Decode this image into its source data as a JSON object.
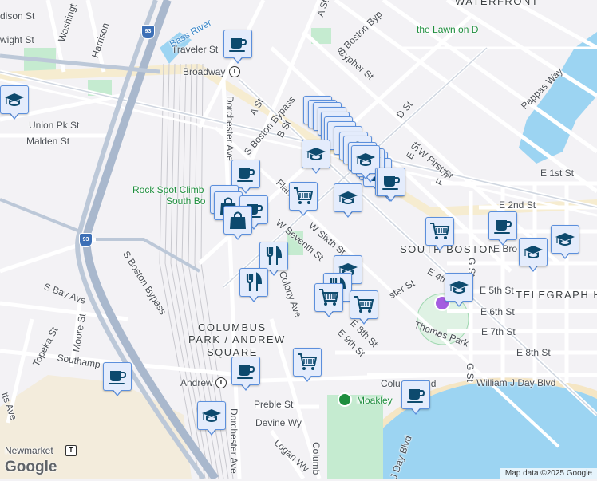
{
  "map": {
    "labels": {
      "waterfront": "WATERFRONT",
      "lawn_on_d": "the Lawn on D",
      "traveler_st": "Traveler St",
      "broadway": "Broadway",
      "bass_river": "Bass River",
      "harrison": "Harrison",
      "washington": "Washingt",
      "wight_st": "wight St",
      "dison_st": "dison St",
      "union_pk_st": "Union Pk St",
      "malden_st": "Malden St",
      "cypher_st": "Cypher St",
      "s_boston_byp_top": "S Boston Byp",
      "a_st_top": "A St",
      "a_st": "A St",
      "s_boston_bypass": "S Boston Bypass",
      "b_st": "B St",
      "dorchester_ave": "Dorchester Ave",
      "d_st": "D St",
      "w_first_st": "W First St",
      "e_st": "E St",
      "f_st": "F St",
      "e_1st_st": "E 1st St",
      "e_2nd_st": "E 2nd St",
      "pappas_way": "Pappas Way",
      "rock_spot": "Rock Spot Climb",
      "south_bo": "South Bo",
      "flaher": "Flaher",
      "w_sixth_st": "W Sixth St",
      "w_seventh_st": "W Seventh St",
      "south_boston": "SOUTH BOSTON",
      "e_bro": "E Bro",
      "e_4th_st": "E 4th St",
      "e_5th_st": "E 5th St",
      "telegraph_hill": "TELEGRAPH HI",
      "e_6th_st": "E 6th St",
      "e_7th_st": "E 7th St",
      "thomas_park": "Thomas Park",
      "g_st": "G St",
      "g_st_2": "G St",
      "e_8th_st": "E 8th St",
      "e_8th_st_2": "E 8th St",
      "e_9th_st": "E 9th St",
      "ster_st": "ster St",
      "colony_ave": "Colony Ave",
      "columbus_1": "COLUMBUS",
      "columbus_2": "PARK / ANDREW",
      "columbus_3": "SQUARE",
      "s_boston_bypass_2": "S Boston Bypass",
      "s_bay_ave": "S Bay Ave",
      "topeka_st": "Topeka St",
      "moore_st": "Moore St",
      "southampton": "Southamp",
      "andrew": "Andrew",
      "columbia_rd": "Columbia Rd",
      "william_j_day": "William J Day Blvd",
      "moakley": "Moakley",
      "preble_st": "Preble St",
      "devine_wy": "Devine Wy",
      "logan_wy": "Logan Wy",
      "columbia_v": "Columb",
      "dorchester_ave_2": "Dorchester Ave",
      "newmarket": "Newmarket",
      "j_day_blvd": "J Day Blvd",
      "tts_ave": "tts Ave"
    },
    "highway_shield": "93",
    "transit_symbol": "T",
    "attribution": "Map data ©2025 Google",
    "logo": "Google",
    "colors": {
      "marker_fill": "#e4ecfc",
      "marker_border": "#5b8fdc",
      "icon": "#0d4a6e",
      "water": "#9cd4f2",
      "park": "#c5ebd0",
      "highway": "#9fb0c8"
    },
    "markers": [
      {
        "type": "coffee"
      },
      {
        "type": "school"
      },
      {
        "type": "shopping"
      },
      {
        "type": "shopping"
      },
      {
        "type": "grocery"
      },
      {
        "type": "shopping"
      },
      {
        "type": "shopping"
      },
      {
        "type": "shopping"
      },
      {
        "type": "shopping"
      },
      {
        "type": "shopping"
      },
      {
        "type": "shopping"
      },
      {
        "type": "school"
      },
      {
        "type": "shopping"
      },
      {
        "type": "shopping"
      },
      {
        "type": "coffee"
      },
      {
        "type": "school"
      },
      {
        "type": "grocery"
      },
      {
        "type": "school"
      },
      {
        "type": "coffee"
      },
      {
        "type": "shopping"
      },
      {
        "type": "shopping"
      },
      {
        "type": "coffee"
      },
      {
        "type": "shopping"
      },
      {
        "type": "shopping"
      },
      {
        "type": "coffee"
      },
      {
        "type": "grocery"
      },
      {
        "type": "restaurant"
      },
      {
        "type": "restaurant"
      },
      {
        "type": "grocery"
      },
      {
        "type": "coffee"
      },
      {
        "type": "school"
      },
      {
        "type": "school"
      },
      {
        "type": "school"
      },
      {
        "type": "school"
      },
      {
        "type": "shopping"
      },
      {
        "type": "restaurant"
      },
      {
        "type": "grocery"
      },
      {
        "type": "grocery"
      },
      {
        "type": "grocery"
      },
      {
        "type": "coffee"
      },
      {
        "type": "coffee"
      },
      {
        "type": "coffee"
      },
      {
        "type": "school"
      }
    ]
  }
}
